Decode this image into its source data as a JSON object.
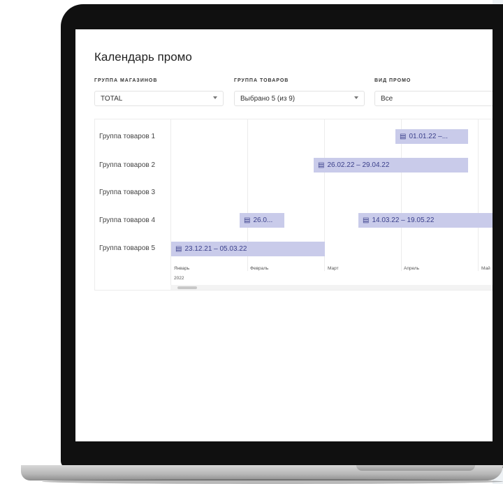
{
  "app": {
    "title": "Календарь промо"
  },
  "filters": [
    {
      "label": "ГРУППА МАГАЗИНОВ",
      "value": "TOTAL"
    },
    {
      "label": "ГРУППА ТОВАРОВ",
      "value": "Выбрано 5 (из 9)"
    },
    {
      "label": "ВИД ПРОМО",
      "value": "Все"
    }
  ],
  "gantt": {
    "rows": [
      "Группа товаров 1",
      "Группа товаров 2",
      "Группа товаров 3",
      "Группа товаров 4",
      "Группа товаров 5"
    ],
    "bars": [
      {
        "label": "01.01.22 –..."
      },
      {
        "label": "26.02.22 – 29.04.22"
      },
      {
        "label": "26.0..."
      },
      {
        "label": "14.03.22 – 19.05.22"
      },
      {
        "label": "23.12.21 – 05.03.22"
      }
    ],
    "months": [
      "Январь",
      "Февраль",
      "Март",
      "Апрель",
      "Май"
    ],
    "year": "2022"
  },
  "icons": {
    "bar_icon": "calendar-icon",
    "select_icon": "chevron-down-icon"
  }
}
